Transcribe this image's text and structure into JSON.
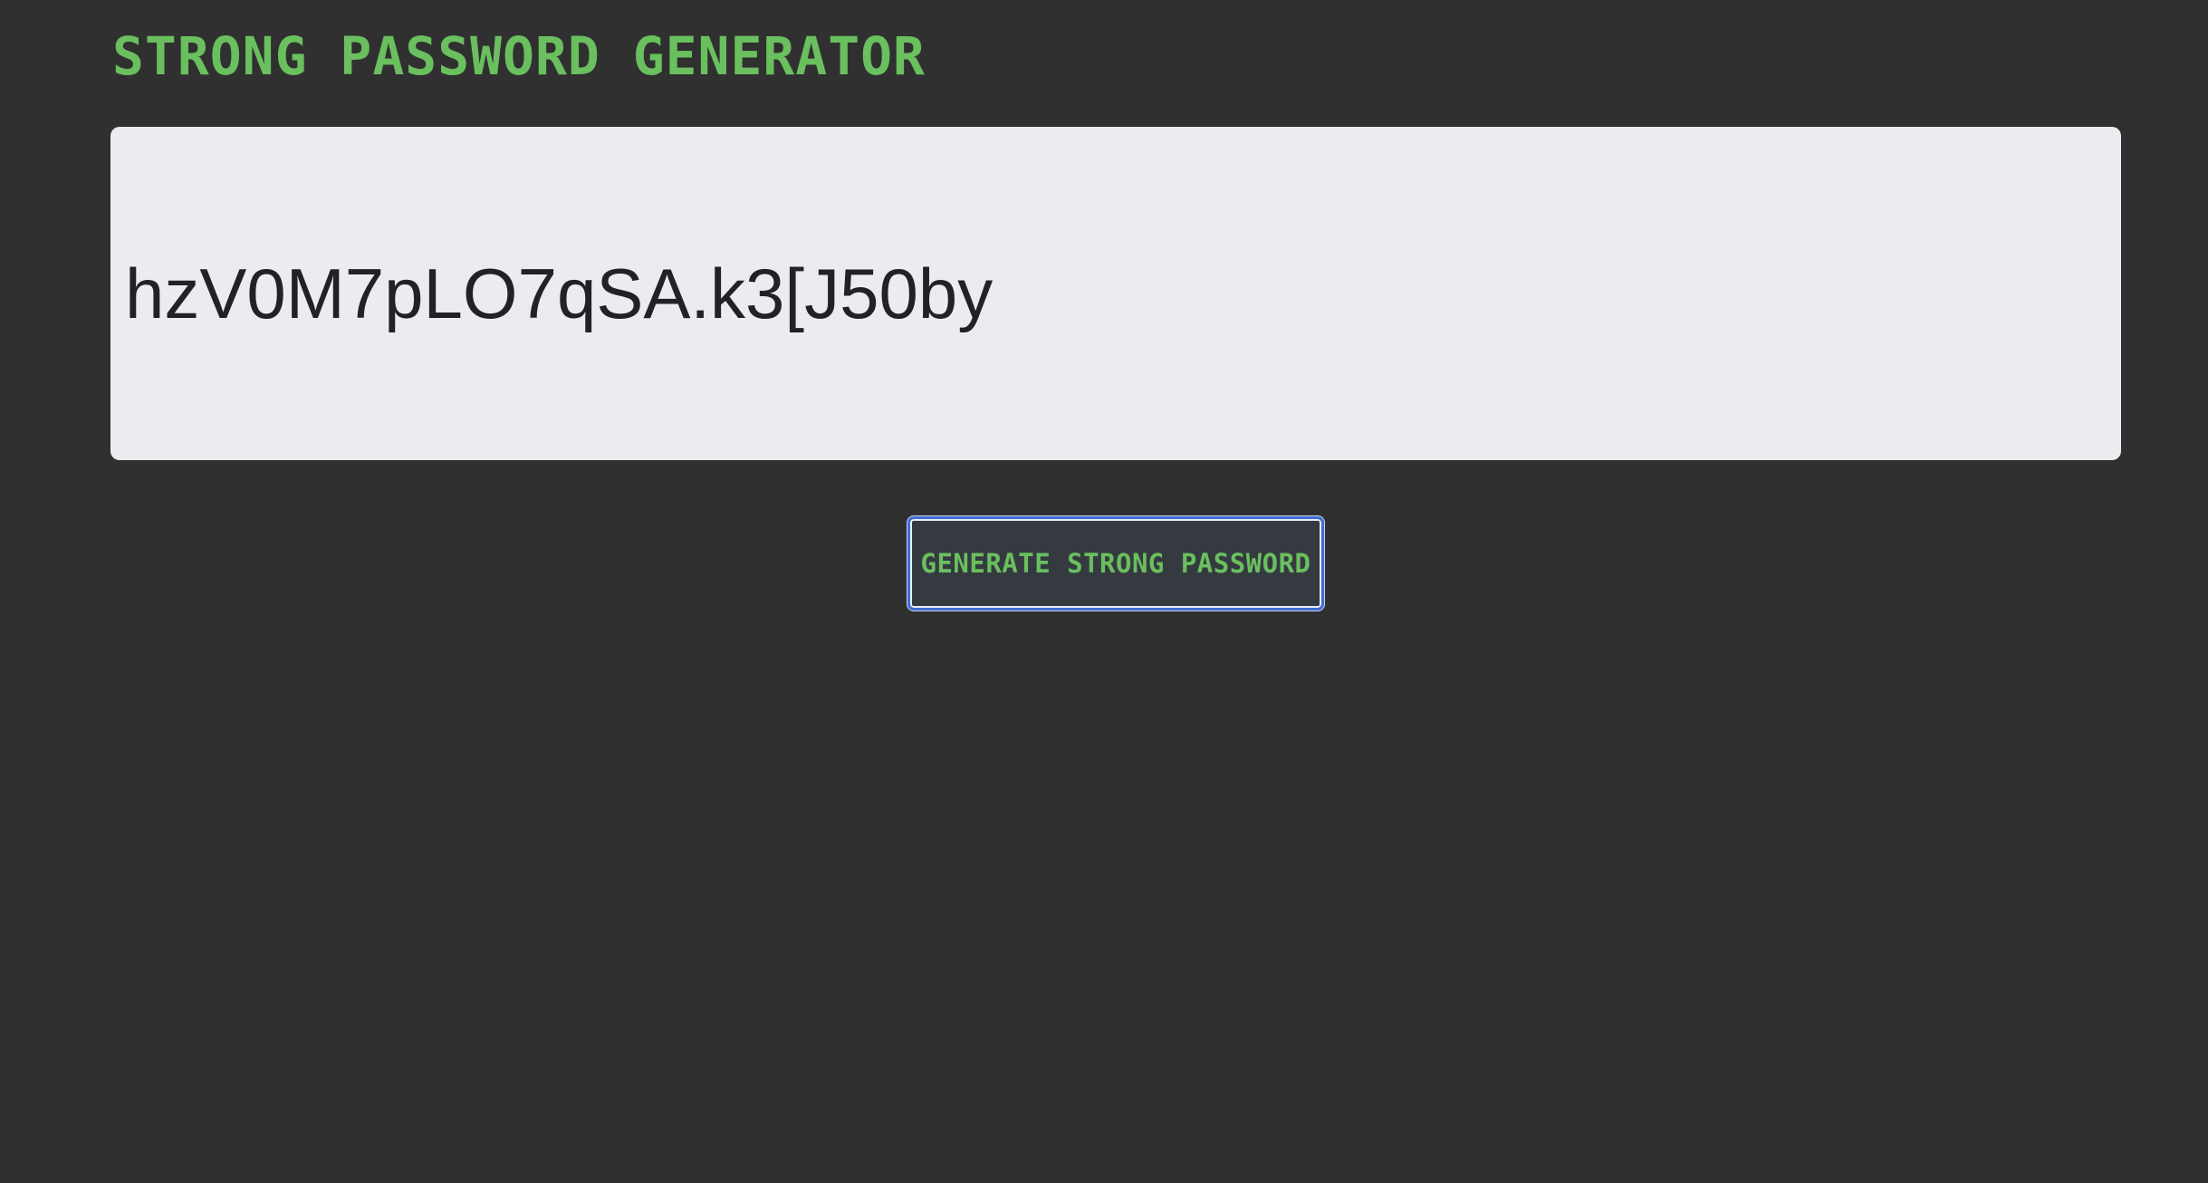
{
  "header": {
    "title": "STRONG PASSWORD GENERATOR"
  },
  "output": {
    "password": "hzV0M7pLO7qSA.k3[J50by"
  },
  "actions": {
    "generate_label": "GENERATE STRONG PASSWORD"
  },
  "colors": {
    "background": "#303030",
    "accent": "#6abf5e",
    "panel": "#ebecf0",
    "focus_ring": "#3f6fd6"
  }
}
